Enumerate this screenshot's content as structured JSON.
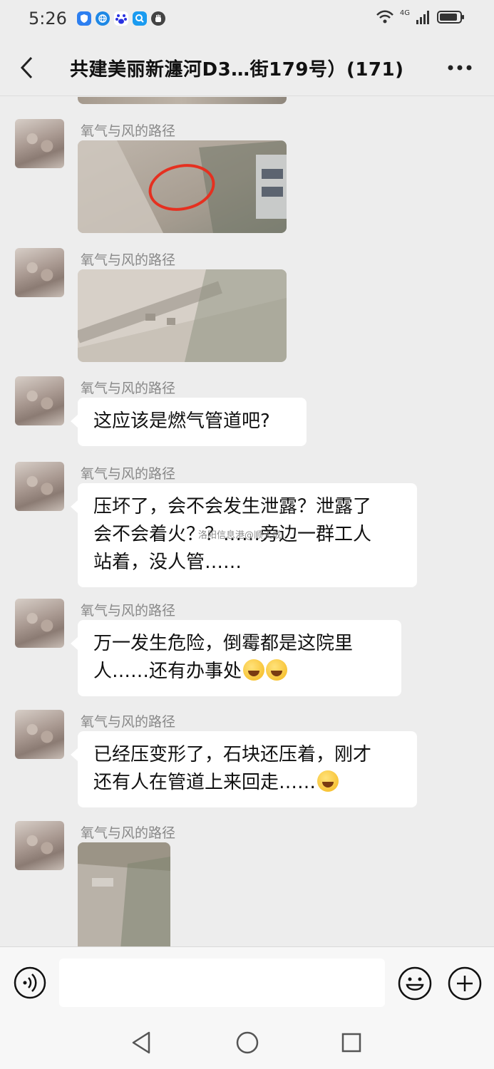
{
  "status": {
    "time": "5:26",
    "network": "4G",
    "left_icons": [
      "shield-app-icon",
      "browser-app-icon",
      "baidu-app-icon",
      "search-app-icon",
      "hand-app-icon"
    ],
    "right_icons": [
      "wifi-icon",
      "signal-icon",
      "battery-icon"
    ]
  },
  "header": {
    "title": "共建美丽新瀍河D3…街179号）(171)",
    "back_icon": "chevron-left-icon",
    "more_icon": "more-dots-icon"
  },
  "messages": [
    {
      "sender": "氧气与风的路径",
      "type": "image",
      "image_desc": "photo with red circle"
    },
    {
      "sender": "氧气与风的路径",
      "type": "image",
      "image_desc": "photo"
    },
    {
      "sender": "氧气与风的路径",
      "type": "text",
      "lines": [
        "这应该是燃气管道吧?"
      ]
    },
    {
      "sender": "氧气与风的路径",
      "type": "text",
      "lines": [
        "压坏了，会不会发生泄露？泄露了",
        "会不会着火？？……旁边一群工人",
        "站着，没人管……"
      ]
    },
    {
      "sender": "氧气与风的路径",
      "type": "text",
      "lines": [
        "万一发生危险，倒霉都是这院里",
        "人……还有办事处"
      ]
    },
    {
      "sender": "氧气与风的路径",
      "type": "text",
      "lines": [
        "已经压变形了，石块还压着，刚才",
        "还有人在管道上来回走……"
      ]
    },
    {
      "sender": "氧气与风的路径",
      "type": "image",
      "image_desc": "photo"
    }
  ],
  "watermark": "洛阳信息港@顺天成",
  "input": {
    "value": "",
    "placeholder": ""
  },
  "colors": {
    "background": "#ededed",
    "bubble": "#ffffff",
    "annotation_circle": "#e53020"
  }
}
